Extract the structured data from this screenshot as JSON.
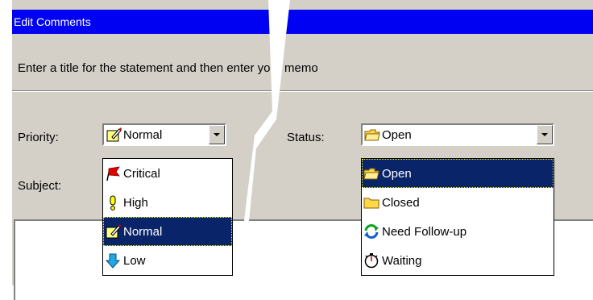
{
  "window": {
    "title": "Edit Comments"
  },
  "instruction": "Enter a title for the statement and then enter your memo",
  "priority": {
    "label": "Priority:",
    "selected": "Normal",
    "options": [
      {
        "label": "Critical",
        "icon": "red-flag-icon"
      },
      {
        "label": "High",
        "icon": "exclamation-icon"
      },
      {
        "label": "Normal",
        "icon": "pencil-note-icon",
        "selected": true
      },
      {
        "label": "Low",
        "icon": "down-arrow-icon"
      }
    ]
  },
  "status": {
    "label": "Status:",
    "selected": "Open",
    "options": [
      {
        "label": "Open",
        "icon": "open-folder-icon",
        "selected": true
      },
      {
        "label": "Closed",
        "icon": "closed-folder-icon"
      },
      {
        "label": "Need Follow-up",
        "icon": "refresh-arrows-icon"
      },
      {
        "label": "Waiting",
        "icon": "stopwatch-icon"
      }
    ]
  },
  "subject": {
    "label": "Subject:"
  },
  "colors": {
    "title_bar": "#0000f2",
    "selection": "#0a246a",
    "face": "#d4d0c8"
  }
}
